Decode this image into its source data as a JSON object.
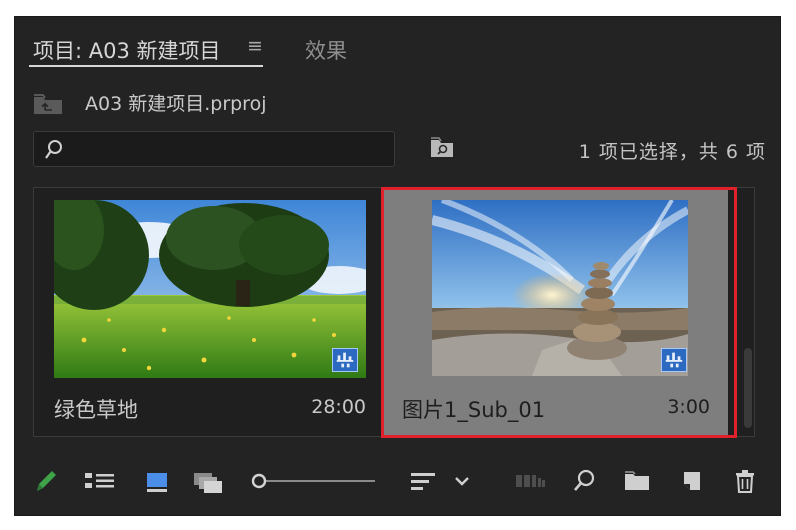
{
  "tabs": {
    "project_label": "项目: A03 新建项目",
    "menu_glyph": "≡",
    "effects_label": "效果"
  },
  "project_path": "A03 新建项目.prproj",
  "search": {
    "placeholder": ""
  },
  "selection_status": "1 项已选择，共 6 项",
  "clips": [
    {
      "name": "绿色草地",
      "duration": "28:00",
      "selected": false,
      "thumbnail": "green-meadow-tree"
    },
    {
      "name": "图片1_Sub_01",
      "duration": "3:00",
      "selected": true,
      "thumbnail": "stone-cairn-sunset"
    }
  ],
  "colors": {
    "panel_bg": "#232323",
    "selected_tile": "#7e7e7e",
    "selection_outline": "#e0202a",
    "badge_blue": "#2b6ac0",
    "pencil_green": "#3fa34a",
    "freeform_active": "#4a8ee8"
  },
  "toolbar_icons": [
    "pencil-icon",
    "list-view-icon",
    "icon-view-icon",
    "freeform-view-icon",
    "zoom-slider",
    "sort-icon",
    "chevron-down-icon",
    "automate-sequence-icon",
    "find-icon",
    "new-bin-icon",
    "new-item-icon",
    "trash-icon"
  ]
}
